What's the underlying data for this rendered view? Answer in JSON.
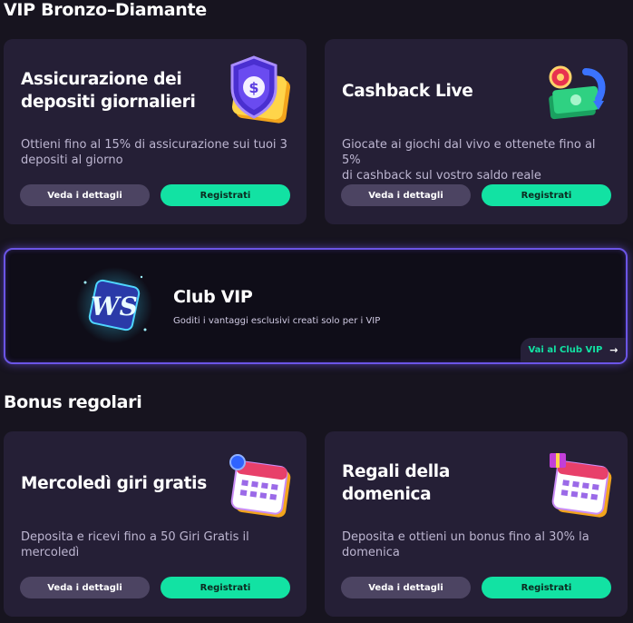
{
  "sections": {
    "vip_heading": "VIP Bronzo–Diamante",
    "regular_heading": "Bonus regolari"
  },
  "cards": [
    {
      "title_line1": "Assicurazione dei",
      "title_line2": "depositi giornalieri",
      "desc_line1": "Ottieni fino al 15% di assicurazione sui tuoi 3",
      "desc_line2": "depositi al giorno",
      "details_label": "Veda i dettagli",
      "register_label": "Registrati",
      "icon": "shield-dollar-icon"
    },
    {
      "title_line1": "Cashback Live",
      "desc_line1": "Giocate ai giochi dal vivo e ottenete fino al 5%",
      "desc_line2": "di cashback sul vostro saldo reale",
      "details_label": "Veda i dettagli",
      "register_label": "Registrati",
      "icon": "cashback-money-icon"
    },
    {
      "title_line1": "Mercoledì giri gratis",
      "desc_line1": "Deposita e ricevi fino a 50 Giri Gratis il",
      "desc_line2": "mercoledì",
      "details_label": "Veda i dettagli",
      "register_label": "Registrati",
      "icon": "calendar-spins-icon"
    },
    {
      "title_line1": "Regali della",
      "title_line2": "domenica",
      "desc_line1": "Deposita e ottieni un bonus fino al 30% la",
      "desc_line2": "domenica",
      "details_label": "Veda i dettagli",
      "register_label": "Registrati",
      "icon": "calendar-gift-icon"
    }
  ],
  "vip_club": {
    "title": "Club VIP",
    "subtitle": "Goditi i vantaggi esclusivi creati solo per i VIP",
    "link_label": "Vai al Club VIP",
    "logo_text": "WS",
    "icon": "ws-logo-icon"
  },
  "colors": {
    "background": "#17141f",
    "card": "#251f36",
    "accent_green": "#12e2a3",
    "vip_border": "#6b55e6"
  }
}
